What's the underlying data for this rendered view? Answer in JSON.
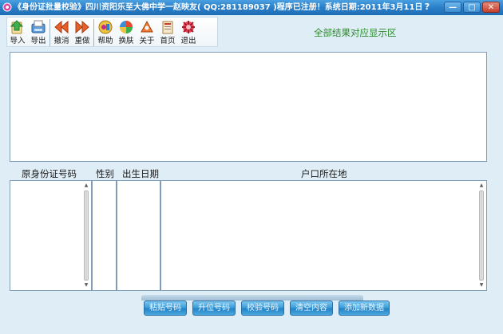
{
  "window": {
    "title": "《身份证批量校验》四川资阳乐至大佛中学一赵映友( QQ:281189037 )程序已注册！系统日期:2011年3月11日",
    "help": "?",
    "minimize": "—",
    "maximize": "□",
    "close": "✕"
  },
  "toolbar": {
    "import": "导入",
    "export": "导出",
    "undo": "撤消",
    "redo": "重做",
    "help": "帮助",
    "skin": "换肤",
    "about": "关于",
    "home": "首页",
    "exit": "退出"
  },
  "result_area": {
    "title": "全部结果对应显示区"
  },
  "columns": {
    "id_number": "原身份证号码",
    "gender": "性别",
    "birth_date": "出生日期",
    "address": "户口所在地"
  },
  "buttons": {
    "paste": "粘贴号码",
    "upgrade": "升位号码",
    "verify": "校验号码",
    "clear": "清空内容",
    "add": "添加新数据"
  },
  "colors": {
    "accent": "#2a7fc8",
    "result_title": "#2a8a2a"
  }
}
